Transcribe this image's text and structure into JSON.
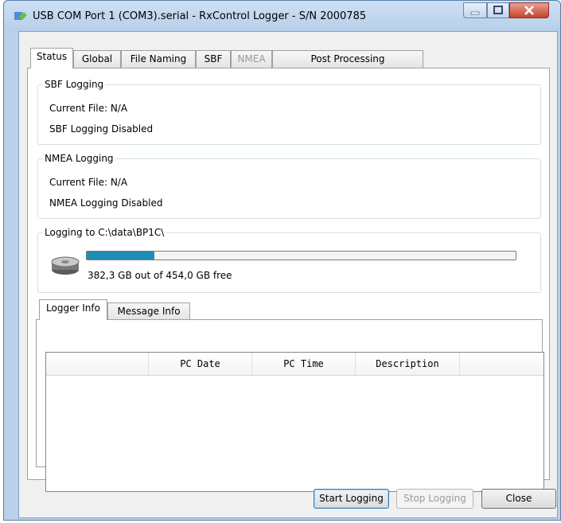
{
  "window": {
    "title": "USB COM Port 1 (COM3).serial - RxControl Logger - S/N 2000785"
  },
  "tabs": [
    {
      "label": "Status",
      "state": "active"
    },
    {
      "label": "Global",
      "state": "normal"
    },
    {
      "label": "File Naming",
      "state": "normal"
    },
    {
      "label": "SBF",
      "state": "normal"
    },
    {
      "label": "NMEA",
      "state": "disabled"
    },
    {
      "label": "Post Processing",
      "state": "normal"
    }
  ],
  "sbf": {
    "title": "SBF Logging",
    "current_file": "Current File:  N/A",
    "status": "SBF Logging Disabled"
  },
  "nmea": {
    "title": "NMEA Logging",
    "current_file": "Current File:  N/A",
    "status": "NMEA Logging Disabled"
  },
  "disk": {
    "title": "Logging to C:\\data\\BP1C\\",
    "free_text": "382,3 GB out of 454,0 GB free",
    "used_fraction": 0.158,
    "bar_color": "#1d8fb3"
  },
  "subtabs": [
    {
      "label": "Logger Info",
      "state": "active"
    },
    {
      "label": "Message Info",
      "state": "normal"
    }
  ],
  "table": {
    "columns": [
      "",
      "PC Date",
      "PC Time",
      "Description",
      ""
    ],
    "rows": []
  },
  "buttons": {
    "start": "Start Logging",
    "stop": "Stop Logging",
    "close": "Close"
  },
  "icons": [
    "app-icon",
    "hard-drive-icon",
    "minimize-icon",
    "maximize-icon",
    "close-icon"
  ]
}
